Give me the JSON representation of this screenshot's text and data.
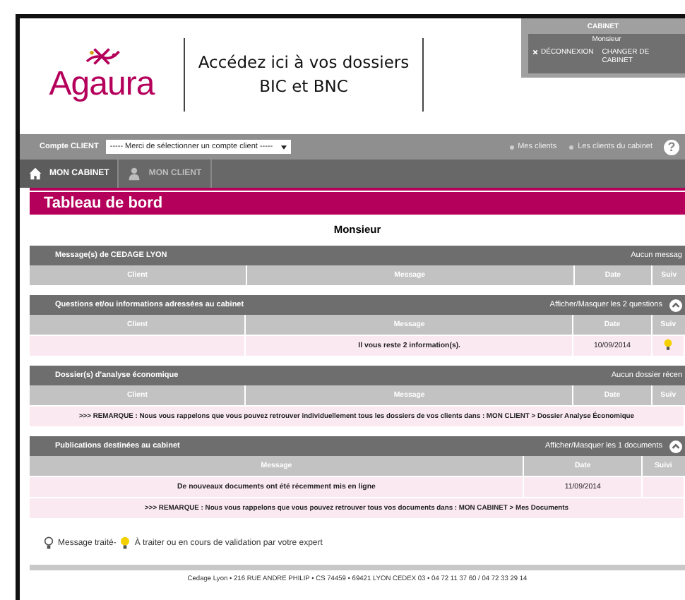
{
  "header": {
    "logo": "Agaura",
    "title_lines": [
      "Accédez ici à vos dossiers",
      "BIC et BNC"
    ],
    "account_box": {
      "cabinet": "CABINET",
      "user": "Monsieur",
      "logout": "DÉCONNEXION",
      "change": "CHANGER DE CABINET"
    }
  },
  "toolbar": {
    "label": "Compte CLIENT",
    "select_value": "----- Merci de sélectionner un compte client -----",
    "radios": [
      {
        "label": "Mes clients",
        "selected": false
      },
      {
        "label": "Les clients du cabinet",
        "selected": false
      }
    ],
    "help": "?"
  },
  "nav": [
    {
      "label": "MON CABINET",
      "kind": "house",
      "selected": true
    },
    {
      "label": "MON CLIENT",
      "kind": "person",
      "selected": false
    }
  ],
  "page_title": "Tableau de bord",
  "greeting": "Monsieur",
  "sections": [
    {
      "title": "Message(s) de CEDAGE LYON",
      "action": "Aucun messag",
      "toggle": false,
      "columns": [
        "Client",
        "Message",
        "Date",
        "Suiv"
      ]
    },
    {
      "title": "Questions et/ou informations adressées au cabinet",
      "action": "Afficher/Masquer les 2 questions",
      "toggle": true,
      "expanded": true,
      "columns": [
        "Client",
        "Message",
        "Date",
        "Suiv"
      ],
      "rows": [
        {
          "kind": "pending",
          "cells": [
            "",
            "Il vous reste 2 information(s).",
            "10/09/2014"
          ]
        }
      ]
    },
    {
      "title": "Dossier(s) d'analyse économique",
      "action": "Aucun dossier récen",
      "toggle": false,
      "columns": [
        "Client",
        "Message",
        "Date",
        "Suiv"
      ],
      "rows": [
        {
          "kind": "remark",
          "text": ">>> REMARQUE : Nous vous rappelons que vous pouvez retrouver individuellement tous les dossiers de vos clients dans : MON CLIENT > Dossier Analyse Économique"
        }
      ]
    },
    {
      "title": "Publications destinées au cabinet",
      "action": "Afficher/Masquer les 1 documents",
      "toggle": true,
      "expanded": true,
      "columns": [
        "Message",
        "Date",
        "Suivi"
      ],
      "rows": [
        {
          "kind": "plain",
          "cells": [
            "De nouveaux documents ont été récemment mis en ligne",
            "11/09/2014"
          ]
        },
        {
          "kind": "remark",
          "text": ">>> REMARQUE : Nous vous rappelons que vous pouvez retrouver tous vos documents dans : MON CABINET > Mes Documents"
        }
      ]
    }
  ],
  "legend": [
    {
      "kind": "done",
      "label": "Message traité-"
    },
    {
      "kind": "pending",
      "label": "À traiter ou en cours de validation par votre expert"
    }
  ],
  "footer": "Cedage Lyon • 216 RUE ANDRE PHILIP • CS 74459 • 69421 LYON CEDEX 03 • 04 72 11 37 60 / 04 72 33 29 14"
}
